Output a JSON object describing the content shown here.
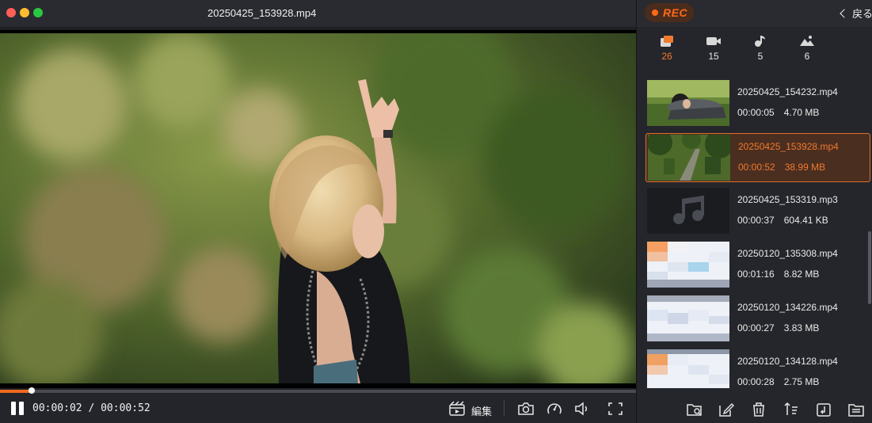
{
  "window": {
    "title": "20250425_153928.mp4"
  },
  "player": {
    "current_time": "00:00:02",
    "duration": "00:00:52",
    "time_separator": "/",
    "progress": 0.05,
    "edit_label": "編集"
  },
  "sidebar": {
    "rec_label": "REC",
    "back_label": "戻る",
    "filters": [
      {
        "icon": "all-media-icon",
        "count": "26",
        "active": true
      },
      {
        "icon": "video-icon",
        "count": "15",
        "active": false
      },
      {
        "icon": "audio-icon",
        "count": "5",
        "active": false
      },
      {
        "icon": "image-icon",
        "count": "6",
        "active": false
      }
    ],
    "files": [
      {
        "name": "20250425_154232.mp4",
        "duration": "00:00:05",
        "size": "4.70 MB",
        "thumb": "video-person",
        "selected": false
      },
      {
        "name": "20250425_153928.mp4",
        "duration": "00:00:52",
        "size": "38.99 MB",
        "thumb": "video-park",
        "selected": true
      },
      {
        "name": "20250425_153319.mp3",
        "duration": "00:00:37",
        "size": "604.41 KB",
        "thumb": "audio",
        "selected": false
      },
      {
        "name": "20250120_135308.mp4",
        "duration": "00:01:16",
        "size": "8.82 MB",
        "thumb": "pixelated",
        "selected": false
      },
      {
        "name": "20250120_134226.mp4",
        "duration": "00:00:27",
        "size": "3.83 MB",
        "thumb": "pixelated",
        "selected": false
      },
      {
        "name": "20250120_134128.mp4",
        "duration": "00:00:28",
        "size": "2.75 MB",
        "thumb": "pixelated",
        "selected": false
      }
    ]
  },
  "colors": {
    "accent": "#f06a1e",
    "panel": "#25262b",
    "selected_bg": "#4a2e20"
  }
}
